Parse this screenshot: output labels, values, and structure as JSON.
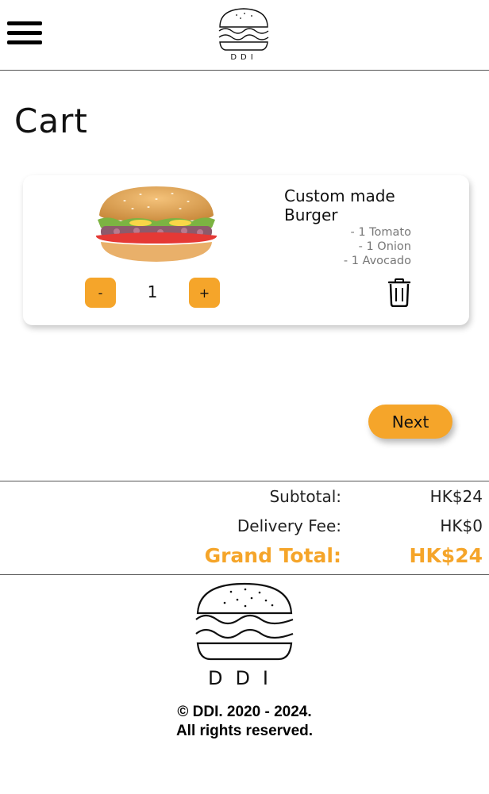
{
  "header": {
    "menu_icon": "hamburger-menu-icon",
    "logo_text": "DDI"
  },
  "page": {
    "title": "Cart"
  },
  "cart_items": [
    {
      "name": "Custom made Burger",
      "toppings": [
        "- 1 Tomato",
        "- 1 Onion",
        "- 1 Avocado"
      ],
      "quantity": "1",
      "decrement_label": "-",
      "increment_label": "+",
      "delete_icon": "trash-icon"
    }
  ],
  "actions": {
    "next_label": "Next"
  },
  "summary": {
    "subtotal_label": "Subtotal:",
    "subtotal_value": "HK$24",
    "delivery_label": "Delivery Fee:",
    "delivery_value": "HK$0",
    "grand_total_label": "Grand Total:",
    "grand_total_value": "HK$24"
  },
  "footer": {
    "logo_text": "DDI",
    "copyright_line1": "© DDI. 2020 - 2024.",
    "copyright_line2": "All rights reserved."
  },
  "colors": {
    "accent": "#F5A52A",
    "text": "#111111",
    "muted": "#777777",
    "divider": "#555555"
  }
}
